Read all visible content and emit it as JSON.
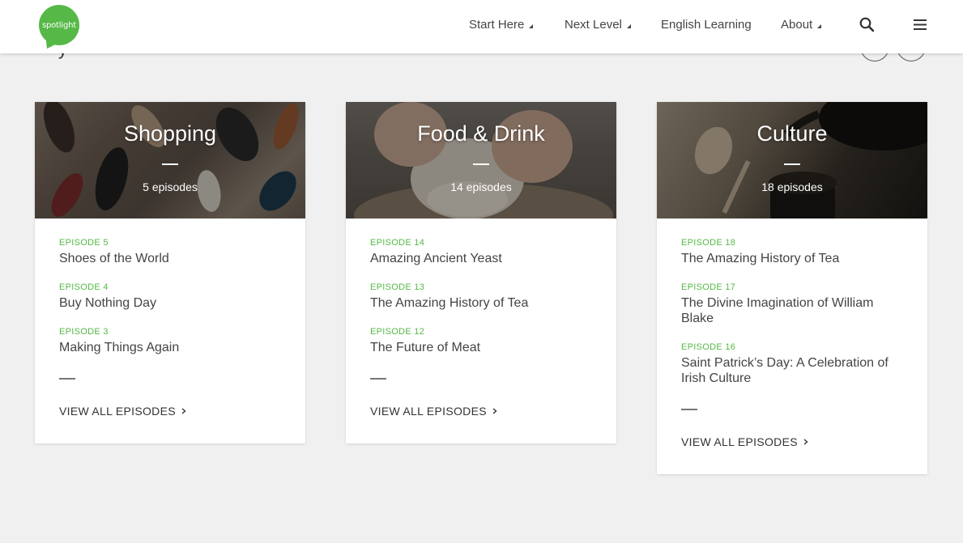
{
  "header": {
    "logo_text": "spotlight",
    "nav": [
      {
        "label": "Start Here",
        "has_caret": true
      },
      {
        "label": "Next Level",
        "has_caret": true
      },
      {
        "label": "English Learning",
        "has_caret": false
      },
      {
        "label": "About",
        "has_caret": true
      }
    ],
    "search_icon": "search-icon",
    "menu_icon": "hamburger-menu-icon"
  },
  "colors": {
    "accent_green": "#56b947",
    "background": "#f0f0f0"
  },
  "cards": [
    {
      "category": "Shopping",
      "count": "5 episodes",
      "episodes": [
        {
          "number": "EPISODE 5",
          "title": "Shoes of the World"
        },
        {
          "number": "EPISODE 4",
          "title": "Buy Nothing Day"
        },
        {
          "number": "EPISODE 3",
          "title": "Making Things Again"
        }
      ],
      "view_all": "VIEW ALL EPISODES"
    },
    {
      "category": "Food & Drink",
      "count": "14 episodes",
      "episodes": [
        {
          "number": "EPISODE 14",
          "title": "Amazing Ancient Yeast"
        },
        {
          "number": "EPISODE 13",
          "title": "The Amazing History of Tea"
        },
        {
          "number": "EPISODE 12",
          "title": "The Future of Meat"
        }
      ],
      "view_all": "VIEW ALL EPISODES"
    },
    {
      "category": "Culture",
      "count": "18 episodes",
      "episodes": [
        {
          "number": "EPISODE 18",
          "title": "The Amazing History of Tea"
        },
        {
          "number": "EPISODE 17",
          "title": "The Divine Imagination of William Blake"
        },
        {
          "number": "EPISODE 16",
          "title": "Saint Patrick’s Day: A Celebration of Irish Culture"
        }
      ],
      "view_all": "VIEW ALL EPISODES"
    }
  ]
}
